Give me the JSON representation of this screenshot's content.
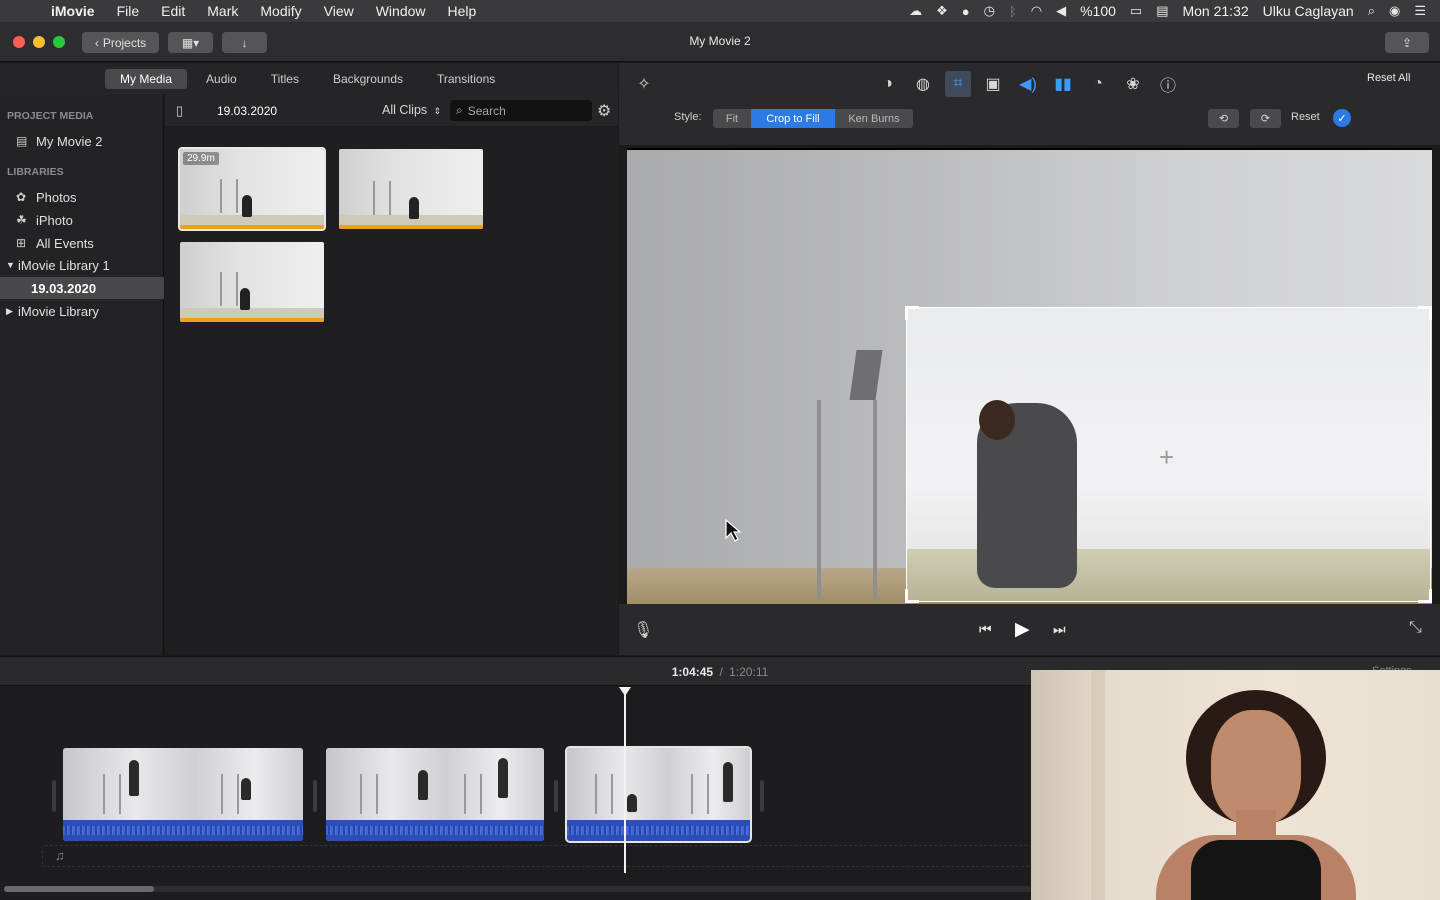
{
  "menubar": {
    "app_name": "iMovie",
    "menus": [
      "File",
      "Edit",
      "Mark",
      "Modify",
      "View",
      "Window",
      "Help"
    ],
    "battery": "%100",
    "clock": "Mon 21:32",
    "user": "Ulku Caglayan"
  },
  "titlebar": {
    "projects_label": "Projects",
    "title": "My Movie 2"
  },
  "media_tabs": [
    "My Media",
    "Audio",
    "Titles",
    "Backgrounds",
    "Transitions"
  ],
  "sidebar": {
    "project_media_header": "PROJECT MEDIA",
    "project_item": "My Movie 2",
    "libraries_header": "LIBRARIES",
    "libraries": [
      "Photos",
      "iPhoto",
      "All Events",
      "iMovie Library 1",
      "19.03.2020",
      "iMovie Library"
    ]
  },
  "browser": {
    "event_title": "19.03.2020",
    "filter": "All Clips",
    "search_placeholder": "Search",
    "clip_duration": "29.9m"
  },
  "viewer": {
    "reset_all": "Reset All",
    "style_label": "Style:",
    "styles": [
      "Fit",
      "Crop to Fill",
      "Ken Burns"
    ],
    "active_style": "Crop to Fill",
    "reset": "Reset"
  },
  "timeline": {
    "current_time": "1:04:45",
    "separator": "/",
    "total_time": "1:20:11",
    "settings": "Settings"
  }
}
